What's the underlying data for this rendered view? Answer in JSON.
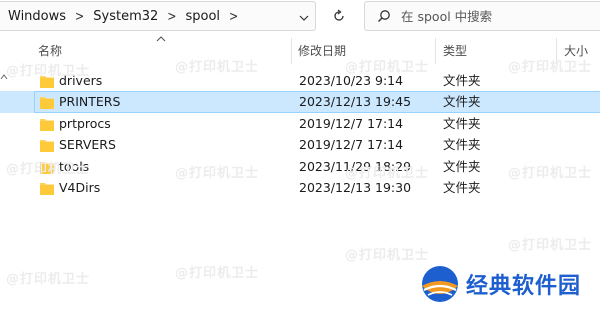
{
  "address_bar": {
    "crumbs": [
      "Windows",
      "System32",
      "spool"
    ]
  },
  "search": {
    "placeholder": "在 spool 中搜索"
  },
  "columns": {
    "name": "名称",
    "modified": "修改日期",
    "type": "类型",
    "size": "大小"
  },
  "rows": [
    {
      "name": "drivers",
      "modified": "2023/10/23 9:14",
      "type": "文件夹",
      "selected": false
    },
    {
      "name": "PRINTERS",
      "modified": "2023/12/13 19:45",
      "type": "文件夹",
      "selected": true
    },
    {
      "name": "prtprocs",
      "modified": "2019/12/7 17:14",
      "type": "文件夹",
      "selected": false
    },
    {
      "name": "SERVERS",
      "modified": "2019/12/7 17:14",
      "type": "文件夹",
      "selected": false
    },
    {
      "name": "tools",
      "modified": "2023/11/29 18:29",
      "type": "文件夹",
      "selected": false
    },
    {
      "name": "V4Dirs",
      "modified": "2023/12/13 19:30",
      "type": "文件夹",
      "selected": false
    }
  ],
  "watermark": "@打印机卫士",
  "brand": {
    "name": "经典软件园"
  },
  "colors": {
    "selection_bg": "#cce8ff",
    "selection_border": "#99d1ff",
    "folder_yellow": "#ffd15c",
    "brand_blue": "#1d5fcf",
    "brand_orange": "#f29a1f"
  }
}
